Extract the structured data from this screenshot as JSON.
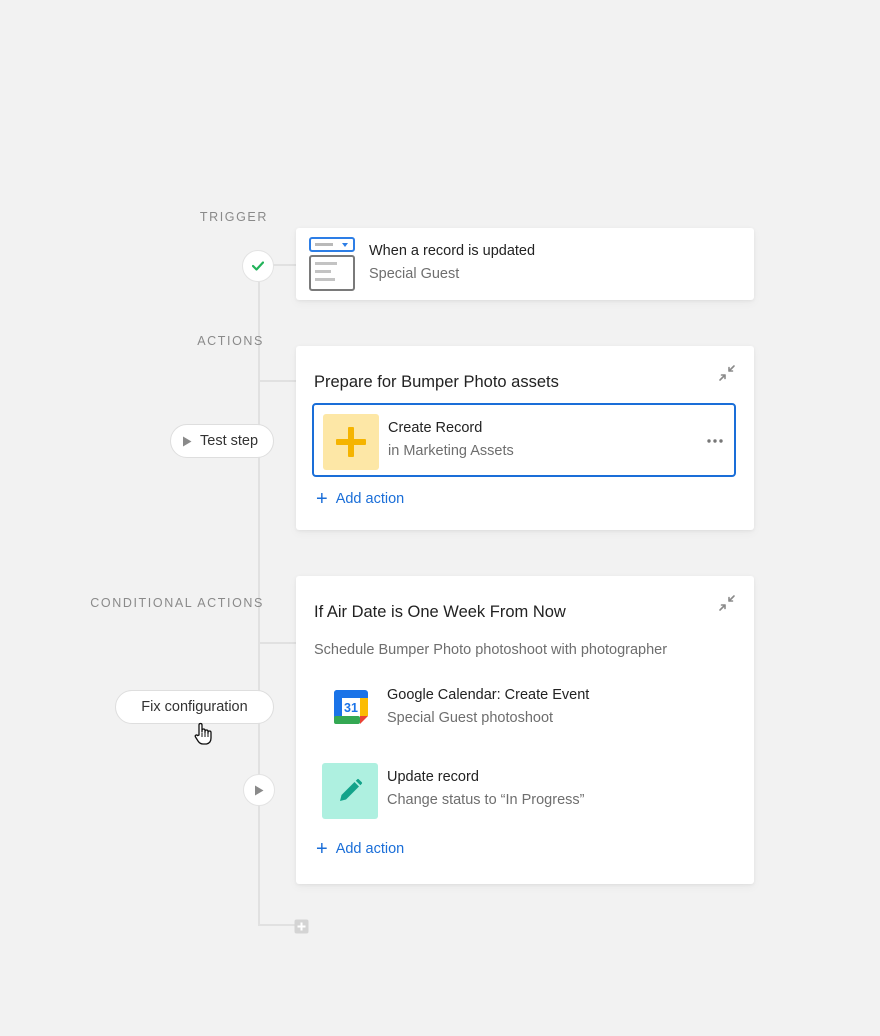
{
  "labels": {
    "trigger": "TRIGGER",
    "actions": "ACTIONS",
    "conditional_actions": "CONDITIONAL ACTIONS"
  },
  "trigger": {
    "title": "When a record is updated",
    "subtitle": "Special Guest"
  },
  "actions_card": {
    "title": "Prepare for Bumper Photo assets",
    "selected_action": {
      "title": "Create Record",
      "subtitle": "in Marketing Assets"
    },
    "add_action": "Add action"
  },
  "test_step": {
    "label": "Test step"
  },
  "conditional_card": {
    "title": "If Air Date is One Week From Now",
    "description": "Schedule Bumper Photo photoshoot with photographer",
    "items": [
      {
        "title": "Google Calendar: Create Event",
        "subtitle": "Special Guest photoshoot",
        "calendar_day": "31"
      },
      {
        "title": "Update record",
        "subtitle": "Change status to “In Progress”"
      }
    ],
    "add_action": "Add action"
  },
  "fix_config": {
    "label": "Fix configuration"
  },
  "colors": {
    "accent": "#1a6ed8",
    "create_tile": "#fde7a6",
    "create_plus": "#f5b400",
    "update_tile": "#aef0e0",
    "update_pencil": "#12a38a",
    "check": "#22b35a"
  },
  "icons": [
    "check-icon",
    "record-form-icon",
    "collapse-icon",
    "play-icon",
    "plus-icon",
    "more-icon",
    "google-calendar-icon",
    "pencil-icon",
    "cursor-hand-icon",
    "add-square-icon"
  ]
}
